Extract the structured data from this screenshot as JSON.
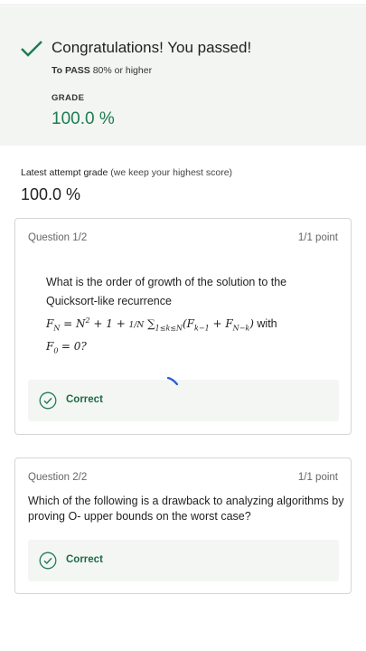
{
  "result": {
    "title": "Congratulations! You passed!",
    "to_pass_label": "To PASS",
    "to_pass_value": "80% or higher",
    "grade_label": "GRADE",
    "grade_value": "100.0 %",
    "accent_color": "#1d7c50"
  },
  "latest_attempt": {
    "label": "Latest attempt grade",
    "note": "(we keep your highest score)",
    "score": "100.0 %"
  },
  "questions": [
    {
      "header": "Question 1/2",
      "points": "1/1 point",
      "text_line1": "What is the order of growth of the solution to the",
      "text_line2": "Quicksort-like recurrence",
      "math_with": "with",
      "math_f0": "= 0?",
      "feedback": "Correct",
      "feedback_icon": "check-circle-icon"
    },
    {
      "header": "Question 2/2",
      "points": "1/1 point",
      "text_line1": "Which of the following is a drawback to analyzing algorithms by",
      "text_line2": "proving O- upper bounds on the worst case?",
      "feedback": "Correct",
      "feedback_icon": "check-circle-icon"
    }
  ],
  "icons": {
    "pass": "checkmark-icon",
    "loading": "loading-spinner-icon"
  }
}
